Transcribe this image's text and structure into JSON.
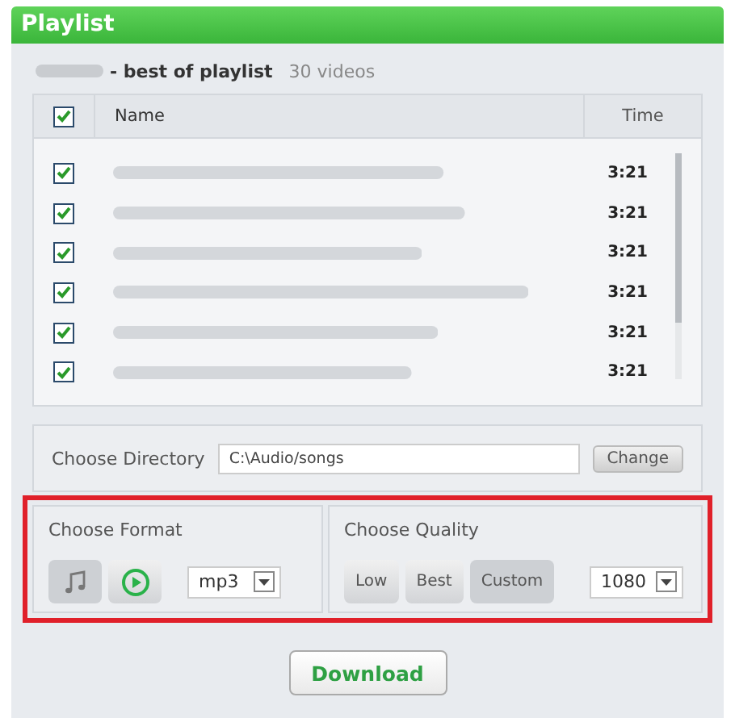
{
  "window": {
    "title": "Playlist"
  },
  "playlist": {
    "title": "- best of playlist",
    "count": "30 videos"
  },
  "table": {
    "all_checked": true,
    "columns": [
      "Name",
      "Time"
    ],
    "rows": [
      {
        "checked": true,
        "time": "3:21"
      },
      {
        "checked": true,
        "time": "3:21"
      },
      {
        "checked": true,
        "time": "3:21"
      },
      {
        "checked": true,
        "time": "3:21"
      },
      {
        "checked": true,
        "time": "3:21"
      },
      {
        "checked": true,
        "time": "3:21"
      }
    ]
  },
  "directory": {
    "label": "Choose Directory",
    "value": "C:\\Audio/songs",
    "button": "Change"
  },
  "format": {
    "label": "Choose Format",
    "options": [
      {
        "kind": "audio",
        "selected": true
      },
      {
        "kind": "video",
        "selected": false
      }
    ],
    "value": "mp3"
  },
  "quality": {
    "label": "Choose Quality",
    "options": [
      {
        "label": "Low",
        "selected": false
      },
      {
        "label": "Best",
        "selected": false
      },
      {
        "label": "Custom",
        "selected": true
      }
    ],
    "value": "1080"
  },
  "download": "Download"
}
